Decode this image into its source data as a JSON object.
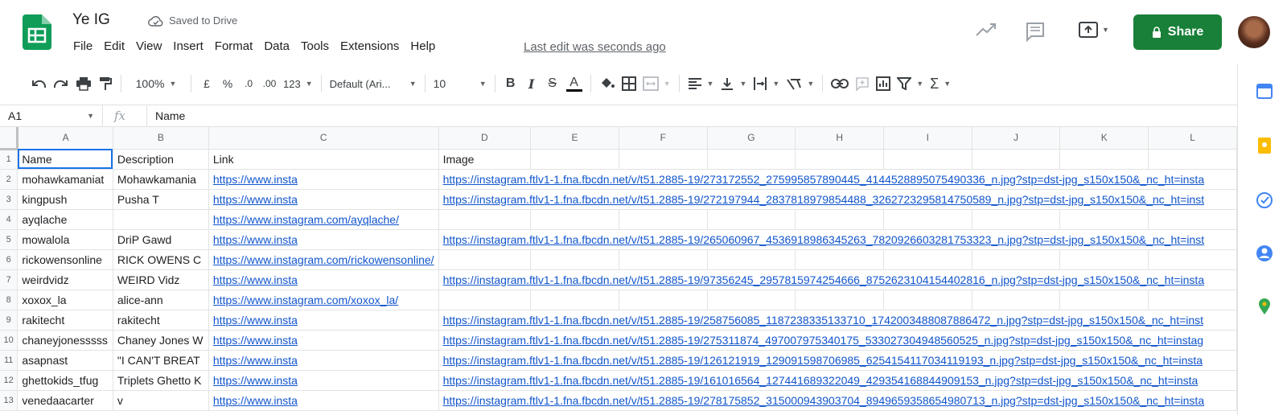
{
  "header": {
    "doc_title": "Ye IG",
    "save_status": "Saved to Drive",
    "last_edit": "Last edit was seconds ago",
    "share_label": "Share",
    "menu": [
      "File",
      "Edit",
      "View",
      "Insert",
      "Format",
      "Data",
      "Tools",
      "Extensions",
      "Help"
    ],
    "brand_color": "#188038"
  },
  "toolbar": {
    "zoom": "100%",
    "currency": "£",
    "percent": "%",
    "dec_decrease": ".0",
    "dec_increase": ".00",
    "number_format": "123",
    "font": "Default (Ari...",
    "font_size": "10",
    "bold": "B",
    "italic": "I",
    "strike": "S",
    "text_color": "A",
    "sum": "Σ"
  },
  "formula_bar": {
    "cell_ref": "A1",
    "fx": "fx",
    "value": "Name"
  },
  "grid": {
    "columns": [
      "A",
      "B",
      "C",
      "D",
      "E",
      "F",
      "G",
      "H",
      "I",
      "J",
      "K",
      "L"
    ],
    "rows": [
      {
        "num": "1",
        "a": "Name",
        "b": "Description",
        "c": "Link",
        "d": "Image"
      },
      {
        "num": "2",
        "a": "mohawkamaniat",
        "b": "Mohawkamania",
        "c": "https://www.insta",
        "d": "https://instagram.ftlv1-1.fna.fbcdn.net/v/t51.2885-19/273172552_275995857890445_4144528895075490336_n.jpg?stp=dst-jpg_s150x150&_nc_ht=insta"
      },
      {
        "num": "3",
        "a": "kingpush",
        "b": "Pusha T",
        "c": "https://www.insta",
        "d": "https://instagram.ftlv1-1.fna.fbcdn.net/v/t51.2885-19/272197944_2837818979854488_3262723295814750589_n.jpg?stp=dst-jpg_s150x150&_nc_ht=inst"
      },
      {
        "num": "4",
        "a": "ayqlache",
        "b": "",
        "c": "https://www.instagram.com/ayqlache/",
        "d": ""
      },
      {
        "num": "5",
        "a": "mowalola",
        "b": "DriP Gawd",
        "c": "https://www.insta",
        "d": "https://instagram.ftlv1-1.fna.fbcdn.net/v/t51.2885-19/265060967_4536918986345263_7820926603281753323_n.jpg?stp=dst-jpg_s150x150&_nc_ht=inst"
      },
      {
        "num": "6",
        "a": "rickowensonline",
        "b": "RICK OWENS C",
        "c": "https://www.instagram.com/rickowensonline/",
        "d": ""
      },
      {
        "num": "7",
        "a": "weirdvidz",
        "b": "WEIRD Vidz",
        "c": "https://www.insta",
        "d": "https://instagram.ftlv1-1.fna.fbcdn.net/v/t51.2885-19/97356245_2957815974254666_8752623104154402816_n.jpg?stp=dst-jpg_s150x150&_nc_ht=insta"
      },
      {
        "num": "8",
        "a": "xoxox_la",
        "b": "alice-ann",
        "c": "https://www.instagram.com/xoxox_la/",
        "d": ""
      },
      {
        "num": "9",
        "a": "rakitecht",
        "b": "rakitecht",
        "c": "https://www.insta",
        "d": "https://instagram.ftlv1-1.fna.fbcdn.net/v/t51.2885-19/258756085_1187238335133710_1742003488087886472_n.jpg?stp=dst-jpg_s150x150&_nc_ht=inst"
      },
      {
        "num": "10",
        "a": "chaneyjonesssss",
        "b": "Chaney Jones W",
        "c": "https://www.insta",
        "d": "https://instagram.ftlv1-1.fna.fbcdn.net/v/t51.2885-19/275311874_497007975340175_533027304948560525_n.jpg?stp=dst-jpg_s150x150&_nc_ht=instag"
      },
      {
        "num": "11",
        "a": "asapnast",
        "b": "\"I CAN'T BREAT",
        "c": "https://www.insta",
        "d": "https://instagram.ftlv1-1.fna.fbcdn.net/v/t51.2885-19/126121919_129091598706985_6254154117034119193_n.jpg?stp=dst-jpg_s150x150&_nc_ht=insta"
      },
      {
        "num": "12",
        "a": "ghettokids_tfug",
        "b": "Triplets Ghetto K",
        "c": "https://www.insta",
        "d": "https://instagram.ftlv1-1.fna.fbcdn.net/v/t51.2885-19/161016564_127441689322049_429354168844909153_n.jpg?stp=dst-jpg_s150x150&_nc_ht=insta"
      },
      {
        "num": "13",
        "a": "venedaacarter",
        "b": "v",
        "c": "https://www.insta",
        "d": "https://instagram.ftlv1-1.fna.fbcdn.net/v/t51.2885-19/278175852_315000943903704_8949659358654980713_n.jpg?stp=dst-jpg_s150x150&_nc_ht=insta"
      }
    ]
  }
}
